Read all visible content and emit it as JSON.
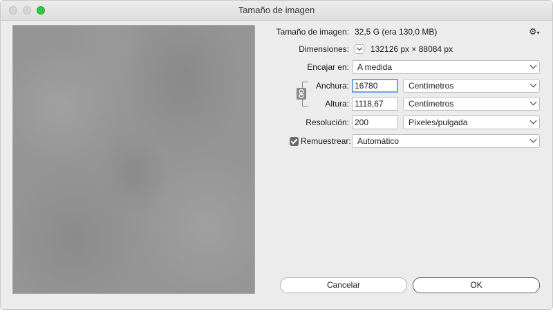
{
  "window": {
    "title": "Tamaño de imagen"
  },
  "info": {
    "size_label": "Tamaño de imagen:",
    "size_value": "32,5 G  (era 130,0 MB)",
    "dimensions_label": "Dimensiones:",
    "dimensions_value": "132126 px × 88084 px"
  },
  "fit": {
    "label": "Encajar en:",
    "value": "A medida"
  },
  "width": {
    "label": "Anchura:",
    "value": "16780",
    "unit": "Centímetros"
  },
  "height": {
    "label": "Altura:",
    "value": "1118,67",
    "unit": "Centímetros"
  },
  "resolution": {
    "label": "Resolución:",
    "value": "200",
    "unit": "Píxeles/pulgada"
  },
  "resample": {
    "label": "Remuestrear:",
    "checked": true,
    "value": "Automático"
  },
  "buttons": {
    "cancel": "Cancelar",
    "ok": "OK"
  },
  "icons": {
    "settings": "gear-icon",
    "link": "chain-link-icon"
  }
}
